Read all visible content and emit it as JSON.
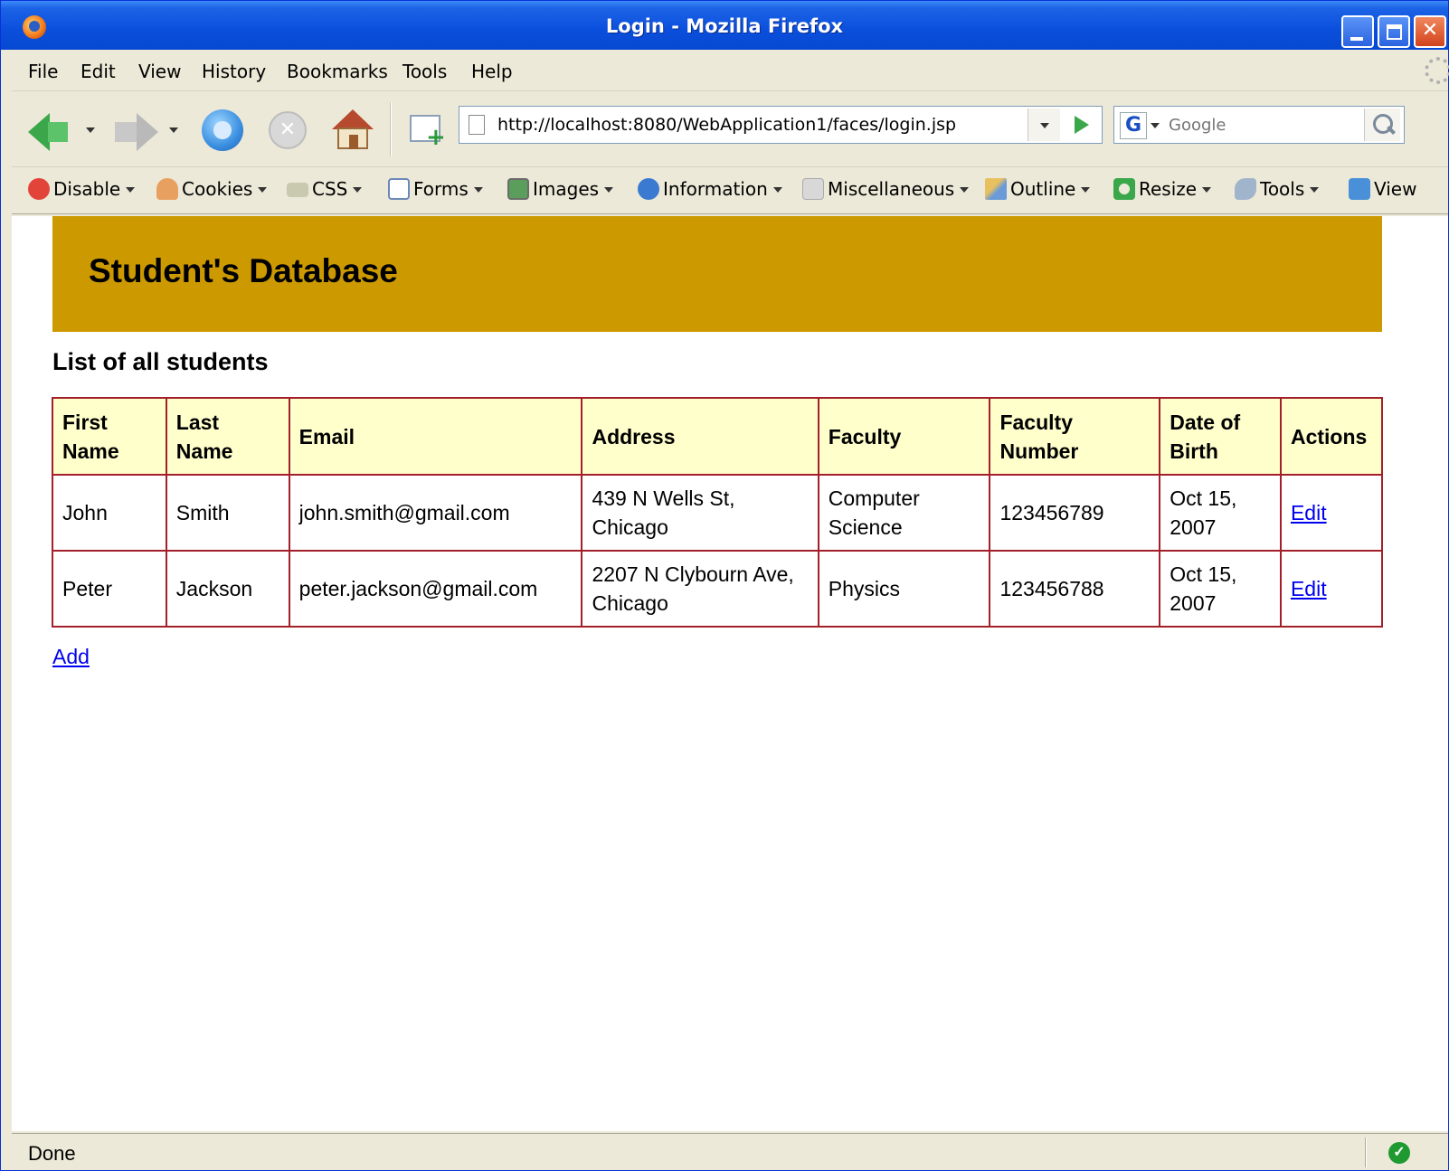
{
  "window": {
    "title": "Login - Mozilla Firefox"
  },
  "menu": [
    "File",
    "Edit",
    "View",
    "History",
    "Bookmarks",
    "Tools",
    "Help"
  ],
  "navigation": {
    "url": "http://localhost:8080/WebApplication1/faces/login.jsp",
    "search_placeholder": "Google",
    "search_engine_letter": "G"
  },
  "devbar": [
    "Disable",
    "Cookies",
    "CSS",
    "Forms",
    "Images",
    "Information",
    "Miscellaneous",
    "Outline",
    "Resize",
    "Tools",
    "View"
  ],
  "page": {
    "banner_title": "Student's Database",
    "subtitle": "List of all students",
    "table": {
      "headers": [
        "First Name",
        "Last Name",
        "Email",
        "Address",
        "Faculty",
        "Faculty Number",
        "Date of Birth",
        "Actions"
      ],
      "rows": [
        {
          "first_name": "John",
          "last_name": "Smith",
          "email": "john.smith@gmail.com",
          "address": "439 N Wells St, Chicago",
          "faculty": "Computer Science",
          "faculty_number": "123456789",
          "date_of_birth": "Oct 15, 2007",
          "action": "Edit"
        },
        {
          "first_name": "Peter",
          "last_name": "Jackson",
          "email": "peter.jackson@gmail.com",
          "address": "2207 N Clybourn Ave, Chicago",
          "faculty": "Physics",
          "faculty_number": "123456788",
          "date_of_birth": "Oct 15, 2007",
          "action": "Edit"
        }
      ]
    },
    "add_label": "Add"
  },
  "status": {
    "text": "Done"
  },
  "colors": {
    "banner": "#cc9900",
    "table_border": "#a31f2a",
    "header_bg": "#ffffcc",
    "link": "#0000ee"
  }
}
